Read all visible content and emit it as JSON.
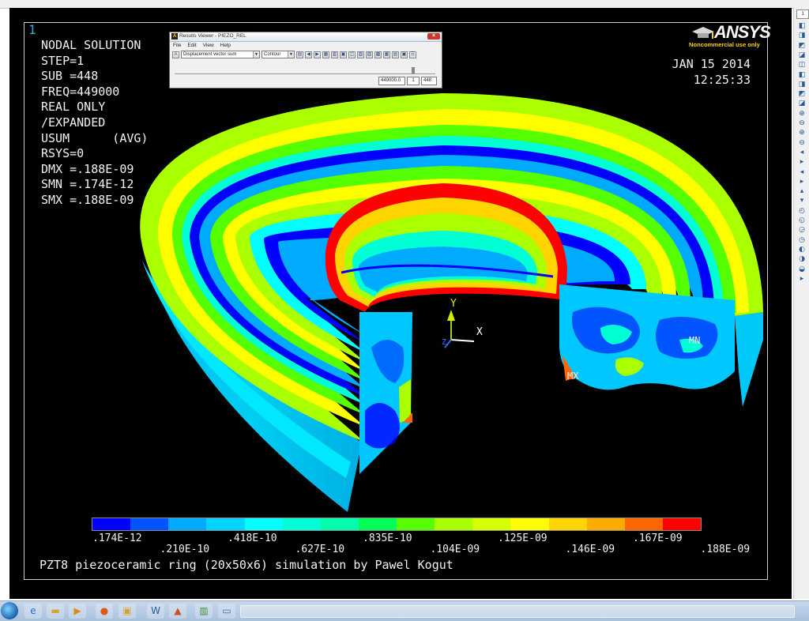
{
  "plot": {
    "window_number": "1",
    "info_lines": [
      "NODAL SOLUTION",
      "",
      "STEP=1",
      "SUB =448",
      "FREQ=449000",
      "REAL ONLY",
      "/EXPANDED",
      "USUM      (AVG)",
      "RSYS=0",
      "DMX =.188E-09",
      "SMN =.174E-12",
      "SMX =.188E-09"
    ],
    "date": "JAN 15 2014",
    "time": "12:25:33",
    "logo_text": "ANSYS",
    "logo_subtext": "Noncommercial use only",
    "caption": "PZT8 piezoceramic ring (20x50x6) simulation by Pawel Kogut",
    "min_marker": "MN",
    "max_marker": "MX",
    "axis_labels": {
      "x": "X",
      "y": "Y",
      "z": "Z"
    },
    "legend": {
      "colors": [
        "#0000ff",
        "#0055ff",
        "#00aaff",
        "#00d4ff",
        "#00ffff",
        "#00ffd4",
        "#00ffaa",
        "#00ff55",
        "#55ff00",
        "#aaff00",
        "#d4ff00",
        "#ffff00",
        "#ffd400",
        "#ffaa00",
        "#ff6600",
        "#ff0000"
      ],
      "labels_bottom_row": [
        ".174E-12",
        ".418E-10",
        ".835E-10",
        ".125E-09",
        ".167E-09"
      ],
      "labels_top_row": [
        ".210E-10",
        ".627E-10",
        ".104E-09",
        ".146E-09",
        ".188E-09"
      ]
    }
  },
  "results_viewer": {
    "title": "Results Viewer - PIEZO_REL",
    "menu": [
      "File",
      "Edit",
      "View",
      "Help"
    ],
    "result_item": "Displacement vector sum",
    "plot_style": "Contour",
    "frequency_value": "449000.0",
    "step_value": "1",
    "substep_value": "448",
    "close_label": "×"
  },
  "toolbar": {
    "window_select": "1"
  },
  "taskbar": {
    "icons": [
      "start-orb",
      "ie-icon",
      "folder-icon",
      "media-icon",
      "firefox-icon",
      "explorer-icon",
      "word-icon",
      "matlab-icon",
      "chart-icon",
      "window-icon"
    ]
  }
}
